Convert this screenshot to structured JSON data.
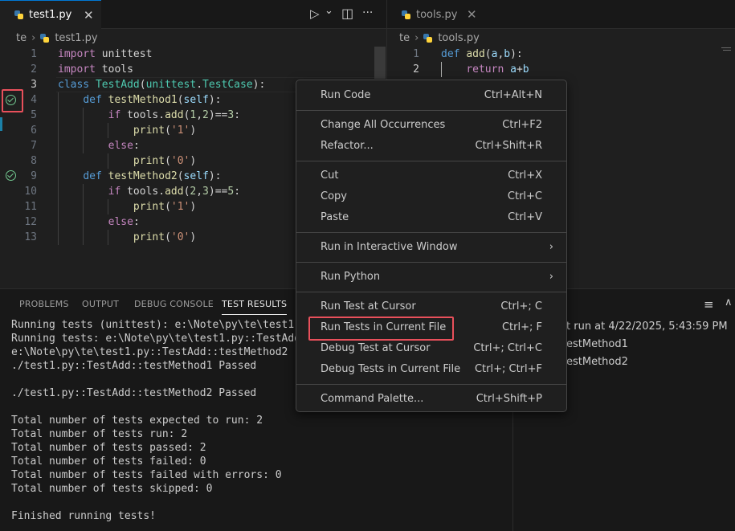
{
  "left_editor": {
    "tab_label": "test1.py",
    "close_glyph": "✕",
    "run_glyph": "▷",
    "dropdown_glyph": "⌄",
    "split_glyph": "◫",
    "more_glyph": "···",
    "breadcrumb": [
      "te",
      "test1.py"
    ],
    "line_numbers": [
      "1",
      "2",
      "3",
      "4",
      "5",
      "6",
      "7",
      "8",
      "9",
      "10",
      "11",
      "12",
      "13"
    ]
  },
  "right_editor": {
    "tab_label": "tools.py",
    "close_glyph": "✕",
    "breadcrumb": [
      "te",
      "tools.py"
    ],
    "line_numbers": [
      "1",
      "2"
    ]
  },
  "code_left": [
    [
      {
        "t": "import",
        "c": "kw2"
      },
      {
        "t": " unittest",
        "c": "plain"
      }
    ],
    [
      {
        "t": "import",
        "c": "kw2"
      },
      {
        "t": " tools",
        "c": "plain"
      }
    ],
    [
      {
        "t": "class",
        "c": "kw"
      },
      {
        "t": " ",
        "c": "plain"
      },
      {
        "t": "TestAdd",
        "c": "cls"
      },
      {
        "t": "(",
        "c": "plain"
      },
      {
        "t": "unittest",
        "c": "cls"
      },
      {
        "t": ".",
        "c": "plain"
      },
      {
        "t": "TestCase",
        "c": "cls"
      },
      {
        "t": "):",
        "c": "plain"
      }
    ],
    [
      {
        "t": "    ",
        "c": "plain"
      },
      {
        "t": "def",
        "c": "kw"
      },
      {
        "t": " ",
        "c": "plain"
      },
      {
        "t": "testMethod1",
        "c": "fn"
      },
      {
        "t": "(",
        "c": "plain"
      },
      {
        "t": "self",
        "c": "var"
      },
      {
        "t": "):",
        "c": "plain"
      }
    ],
    [
      {
        "t": "        ",
        "c": "plain"
      },
      {
        "t": "if",
        "c": "kw2"
      },
      {
        "t": " tools.",
        "c": "plain"
      },
      {
        "t": "add",
        "c": "fn"
      },
      {
        "t": "(",
        "c": "plain"
      },
      {
        "t": "1",
        "c": "num"
      },
      {
        "t": ",",
        "c": "plain"
      },
      {
        "t": "2",
        "c": "num"
      },
      {
        "t": ")==",
        "c": "plain"
      },
      {
        "t": "3",
        "c": "num"
      },
      {
        "t": ":",
        "c": "plain"
      }
    ],
    [
      {
        "t": "            ",
        "c": "plain"
      },
      {
        "t": "print",
        "c": "fn"
      },
      {
        "t": "(",
        "c": "plain"
      },
      {
        "t": "'1'",
        "c": "str"
      },
      {
        "t": ")",
        "c": "plain"
      }
    ],
    [
      {
        "t": "        ",
        "c": "plain"
      },
      {
        "t": "else",
        "c": "kw2"
      },
      {
        "t": ":",
        "c": "plain"
      }
    ],
    [
      {
        "t": "            ",
        "c": "plain"
      },
      {
        "t": "print",
        "c": "fn"
      },
      {
        "t": "(",
        "c": "plain"
      },
      {
        "t": "'0'",
        "c": "str"
      },
      {
        "t": ")",
        "c": "plain"
      }
    ],
    [
      {
        "t": "    ",
        "c": "plain"
      },
      {
        "t": "def",
        "c": "kw"
      },
      {
        "t": " ",
        "c": "plain"
      },
      {
        "t": "testMethod2",
        "c": "fn"
      },
      {
        "t": "(",
        "c": "plain"
      },
      {
        "t": "self",
        "c": "var"
      },
      {
        "t": "):",
        "c": "plain"
      }
    ],
    [
      {
        "t": "        ",
        "c": "plain"
      },
      {
        "t": "if",
        "c": "kw2"
      },
      {
        "t": " tools.",
        "c": "plain"
      },
      {
        "t": "add",
        "c": "fn"
      },
      {
        "t": "(",
        "c": "plain"
      },
      {
        "t": "2",
        "c": "num"
      },
      {
        "t": ",",
        "c": "plain"
      },
      {
        "t": "3",
        "c": "num"
      },
      {
        "t": ")==",
        "c": "plain"
      },
      {
        "t": "5",
        "c": "num"
      },
      {
        "t": ":",
        "c": "plain"
      }
    ],
    [
      {
        "t": "            ",
        "c": "plain"
      },
      {
        "t": "print",
        "c": "fn"
      },
      {
        "t": "(",
        "c": "plain"
      },
      {
        "t": "'1'",
        "c": "str"
      },
      {
        "t": ")",
        "c": "plain"
      }
    ],
    [
      {
        "t": "        ",
        "c": "plain"
      },
      {
        "t": "else",
        "c": "kw2"
      },
      {
        "t": ":",
        "c": "plain"
      }
    ],
    [
      {
        "t": "            ",
        "c": "plain"
      },
      {
        "t": "print",
        "c": "fn"
      },
      {
        "t": "(",
        "c": "plain"
      },
      {
        "t": "'0'",
        "c": "str"
      },
      {
        "t": ")",
        "c": "plain"
      }
    ]
  ],
  "code_right": [
    [
      {
        "t": "def",
        "c": "kw"
      },
      {
        "t": " ",
        "c": "plain"
      },
      {
        "t": "add",
        "c": "fn"
      },
      {
        "t": "(",
        "c": "plain"
      },
      {
        "t": "a",
        "c": "var"
      },
      {
        "t": ",",
        "c": "plain"
      },
      {
        "t": "b",
        "c": "var"
      },
      {
        "t": "):",
        "c": "plain"
      }
    ],
    [
      {
        "t": "    ",
        "c": "plain"
      },
      {
        "t": "return",
        "c": "kw2"
      },
      {
        "t": " ",
        "c": "plain"
      },
      {
        "t": "a",
        "c": "var"
      },
      {
        "t": "+",
        "c": "plain"
      },
      {
        "t": "b",
        "c": "var"
      }
    ]
  ],
  "panel": {
    "tabs": [
      "PROBLEMS",
      "OUTPUT",
      "DEBUG CONSOLE",
      "TEST RESULTS"
    ],
    "terminal_lines": [
      "Running tests (unittest): e:\\Note\\py\\te\\test1.",
      "Running tests: e:\\Note\\py\\te\\test1.py::TestAdd",
      "e:\\Note\\py\\te\\test1.py::TestAdd::testMethod2",
      "./test1.py::TestAdd::testMethod1 Passed",
      "",
      "./test1.py::TestAdd::testMethod2 Passed",
      "",
      "Total number of tests expected to run: 2",
      "Total number of tests run: 2",
      "Total number of tests passed: 2",
      "Total number of tests failed: 0",
      "Total number of tests failed with errors: 0",
      "Total number of tests skipped: 0",
      "",
      "Finished running tests!"
    ],
    "right_list": [
      "t run at 4/22/2025, 5:43:59 PM",
      "estMethod1",
      "estMethod2"
    ],
    "clear_glyph": "≡",
    "collapse_glyph": "∧"
  },
  "context_menu": {
    "groups": [
      [
        {
          "label": "Run Code",
          "key": "Ctrl+Alt+N"
        }
      ],
      [
        {
          "label": "Change All Occurrences",
          "key": "Ctrl+F2"
        },
        {
          "label": "Refactor...",
          "key": "Ctrl+Shift+R"
        }
      ],
      [
        {
          "label": "Cut",
          "key": "Ctrl+X"
        },
        {
          "label": "Copy",
          "key": "Ctrl+C"
        },
        {
          "label": "Paste",
          "key": "Ctrl+V"
        }
      ],
      [
        {
          "label": "Run in Interactive Window",
          "key": "",
          "submenu": true
        }
      ],
      [
        {
          "label": "Run Python",
          "key": "",
          "submenu": true
        }
      ],
      [
        {
          "label": "Run Test at Cursor",
          "key": "Ctrl+; C"
        },
        {
          "label": "Run Tests in Current File",
          "key": "Ctrl+; F",
          "highlight": true
        },
        {
          "label": "Debug Test at Cursor",
          "key": "Ctrl+; Ctrl+C"
        },
        {
          "label": "Debug Tests in Current File",
          "key": "Ctrl+; Ctrl+F"
        }
      ],
      [
        {
          "label": "Command Palette...",
          "key": "Ctrl+Shift+P"
        }
      ]
    ]
  },
  "colors": {
    "accent": "#0078d4",
    "highlight_box": "#e8505b",
    "pass": "#73c991"
  }
}
